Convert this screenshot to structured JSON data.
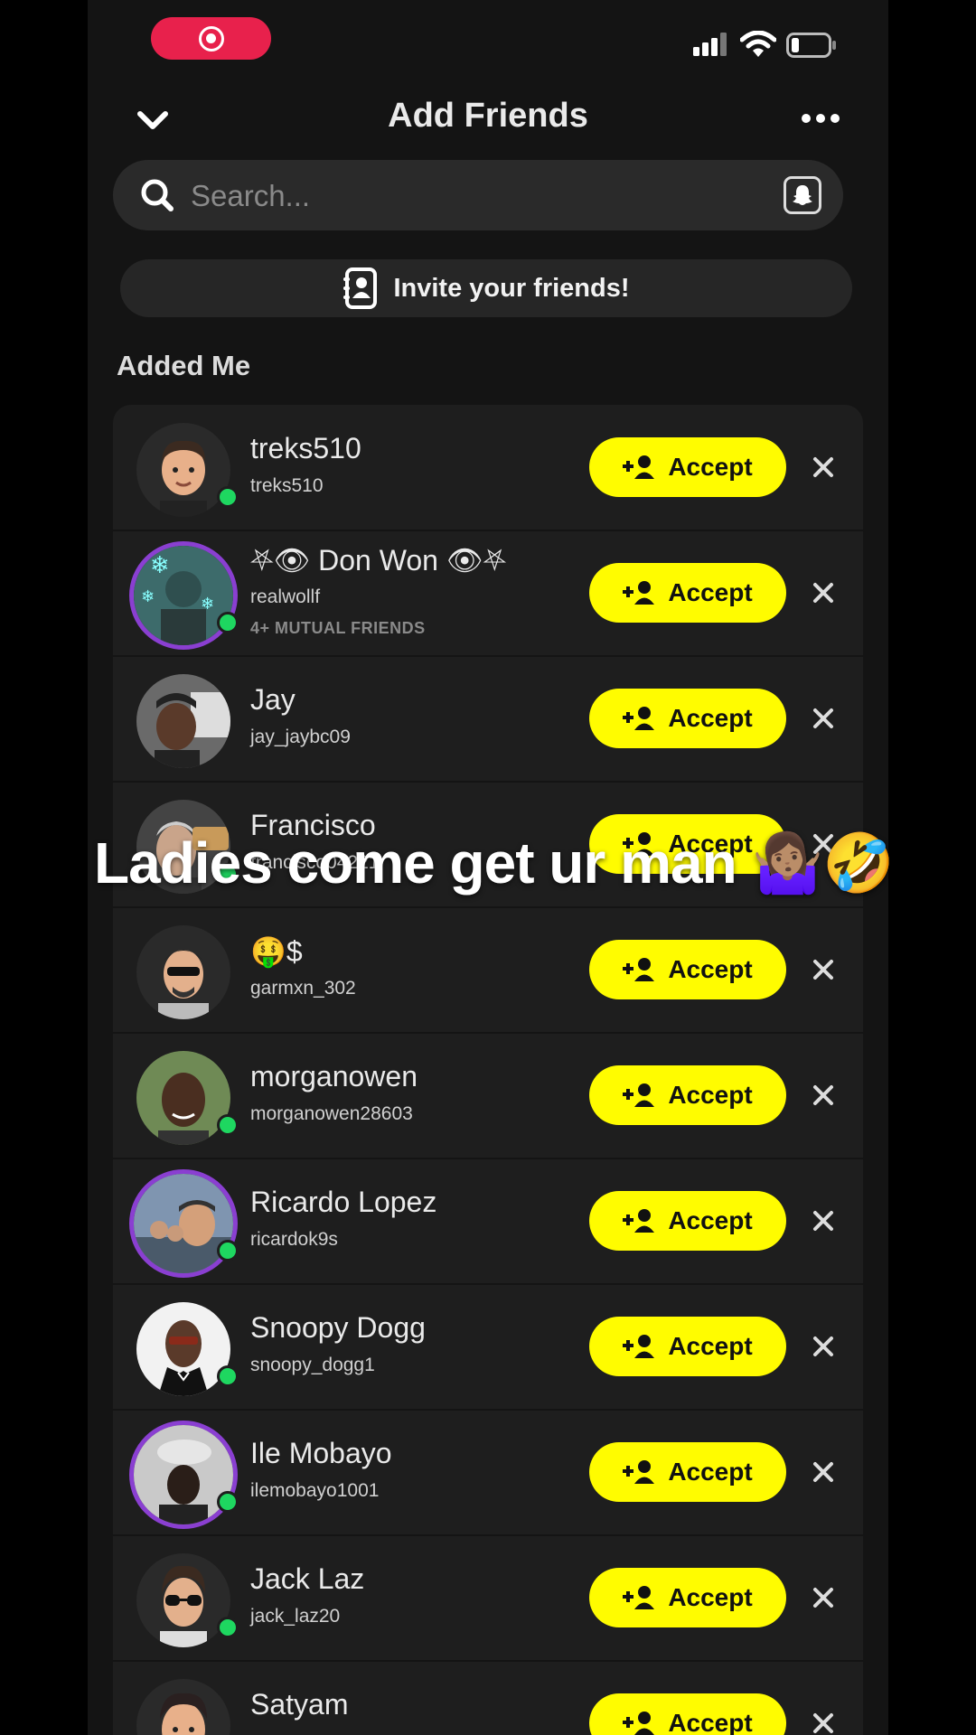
{
  "header": {
    "title": "Add Friends"
  },
  "search": {
    "placeholder": "Search..."
  },
  "invite": {
    "label": "Invite your friends!"
  },
  "section": {
    "title": "Added Me"
  },
  "overlay": {
    "caption": "Ladies come get ur man 🤷🏽‍♀️🤣"
  },
  "accept_label": "Accept",
  "colors": {
    "accent": "#fffc00",
    "record": "#e8214c",
    "online": "#1ed760",
    "story_ring": "#8a3fd1",
    "background": "#141414",
    "row": "#1e1e1e"
  },
  "friends": [
    {
      "name": "treks510",
      "username": "treks510",
      "mutual": ""
    },
    {
      "name": "⛧👁 Don Won 👁⛧",
      "username": "realwollf",
      "mutual": "4+ MUTUAL FRIENDS"
    },
    {
      "name": "Jay",
      "username": "jay_jaybc09",
      "mutual": ""
    },
    {
      "name": "Francisco",
      "username": "francisco04221",
      "mutual": ""
    },
    {
      "name": "🤑$",
      "username": "garmxn_302",
      "mutual": ""
    },
    {
      "name": "morganowen",
      "username": "morganowen28603",
      "mutual": ""
    },
    {
      "name": "Ricardo Lopez",
      "username": "ricardok9s",
      "mutual": ""
    },
    {
      "name": "Snoopy Dogg",
      "username": "snoopy_dogg1",
      "mutual": ""
    },
    {
      "name": "Ile Mobayo",
      "username": "ilemobayo1001",
      "mutual": ""
    },
    {
      "name": "Jack Laz",
      "username": "jack_laz20",
      "mutual": ""
    },
    {
      "name": "Satyam",
      "username": "",
      "mutual": ""
    }
  ]
}
